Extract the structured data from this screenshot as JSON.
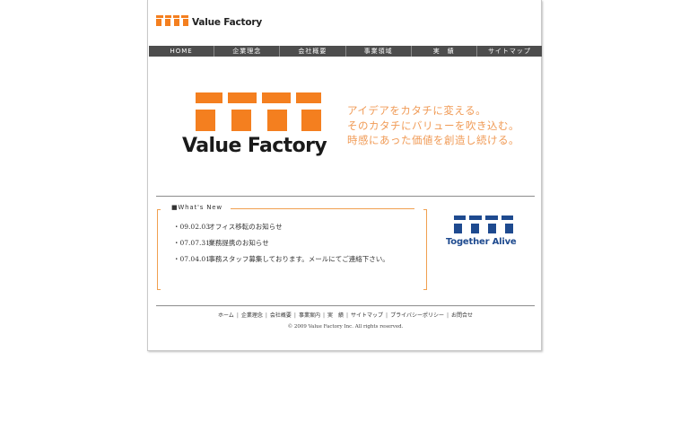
{
  "header": {
    "logo_text": "Value Factory"
  },
  "nav": [
    "HOME",
    "企業理念",
    "会社概要",
    "事業領域",
    "実　績",
    "サイトマップ"
  ],
  "hero": {
    "logo_text": "Value Factory",
    "tagline": [
      "アイデアをカタチに変える。",
      "そのカタチにバリューを吹き込む。",
      "時感にあった価値を創造し続ける。"
    ]
  },
  "news": {
    "title": "■What's New",
    "items": [
      {
        "date": "・09.02.03",
        "text": "オフィス移転のお知らせ"
      },
      {
        "date": "・07.07.31",
        "text": "業務提携のお知らせ"
      },
      {
        "date": "・07.04.01",
        "text": "事務スタッフ募集しております。メールにてご連絡下さい。"
      }
    ]
  },
  "together": {
    "text": "Together Alive"
  },
  "footer": {
    "links": [
      "ホーム",
      "企業理念",
      "会社概要",
      "事業案内",
      "実　績",
      "サイトマップ",
      "プライバシーポリシー",
      "お問合せ"
    ],
    "separator": "|",
    "copyright": "© 2009 Value Factory Inc. All rights reserved."
  },
  "colors": {
    "orange": "#f47f1f",
    "tagline": "#f09a55",
    "nav_bg": "#4d4d4d",
    "blue": "#1e4a8f"
  }
}
